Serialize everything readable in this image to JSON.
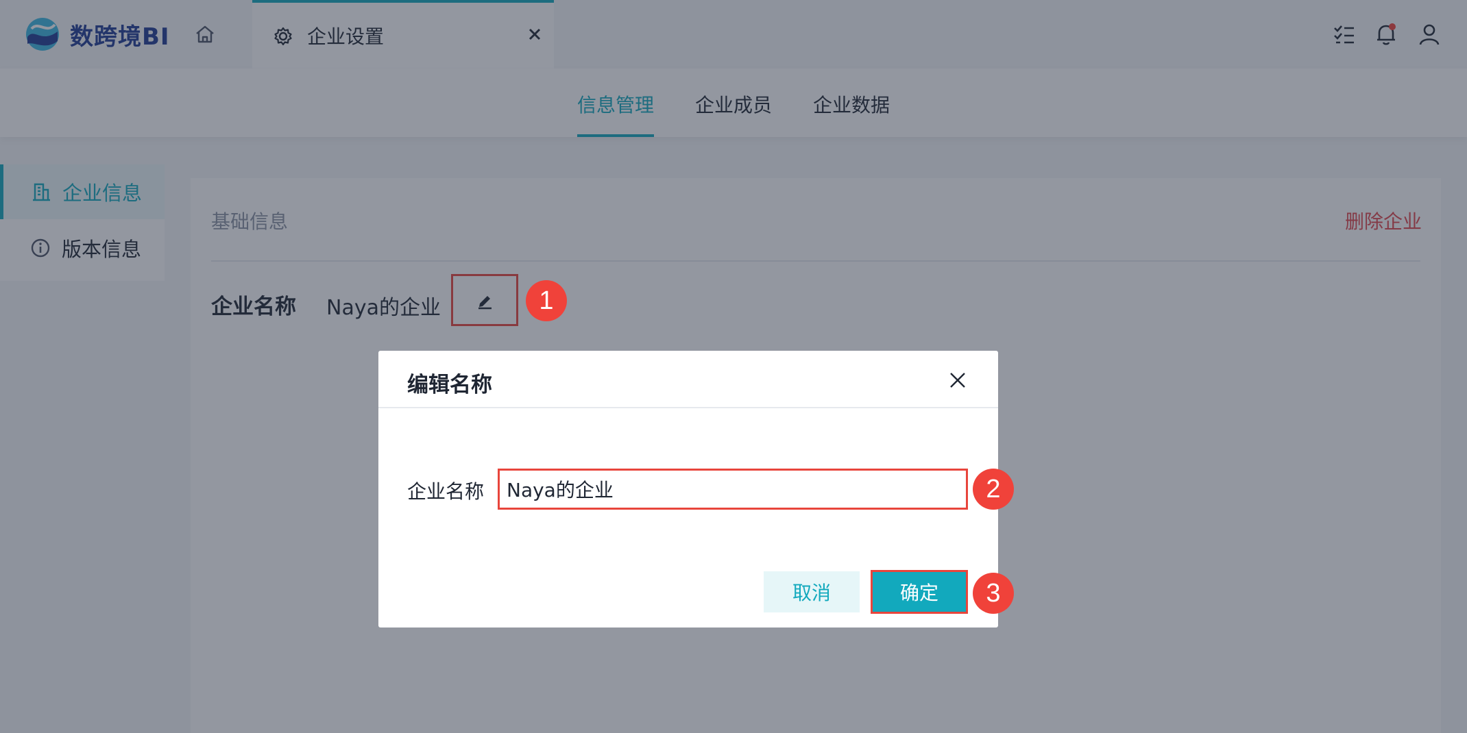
{
  "app": {
    "logo_text": "数跨境BI"
  },
  "tabs": {
    "active_label": "企业设置"
  },
  "subnav": {
    "items": [
      "信息管理",
      "企业成员",
      "企业数据"
    ]
  },
  "sidebar": {
    "items": [
      {
        "label": "企业信息"
      },
      {
        "label": "版本信息"
      }
    ]
  },
  "card": {
    "section_title": "基础信息",
    "delete_label": "删除企业",
    "name_label": "企业名称",
    "name_value": "Naya的企业"
  },
  "modal": {
    "title": "编辑名称",
    "field_label": "企业名称",
    "field_value": "Naya的企业",
    "cancel_label": "取消",
    "ok_label": "确定"
  },
  "steps": [
    "1",
    "2",
    "3"
  ],
  "icons": {
    "home": "home-icon",
    "gear": "gear-icon",
    "close": "close-icon",
    "list": "task-list-icon",
    "bell": "bell-icon",
    "user": "user-icon",
    "building": "building-icon",
    "info": "info-icon",
    "edit": "edit-icon"
  },
  "colors": {
    "accent": "#12a9bd",
    "danger": "#e0474d",
    "highlight": "#e8453c",
    "badge": "#f0423a"
  }
}
